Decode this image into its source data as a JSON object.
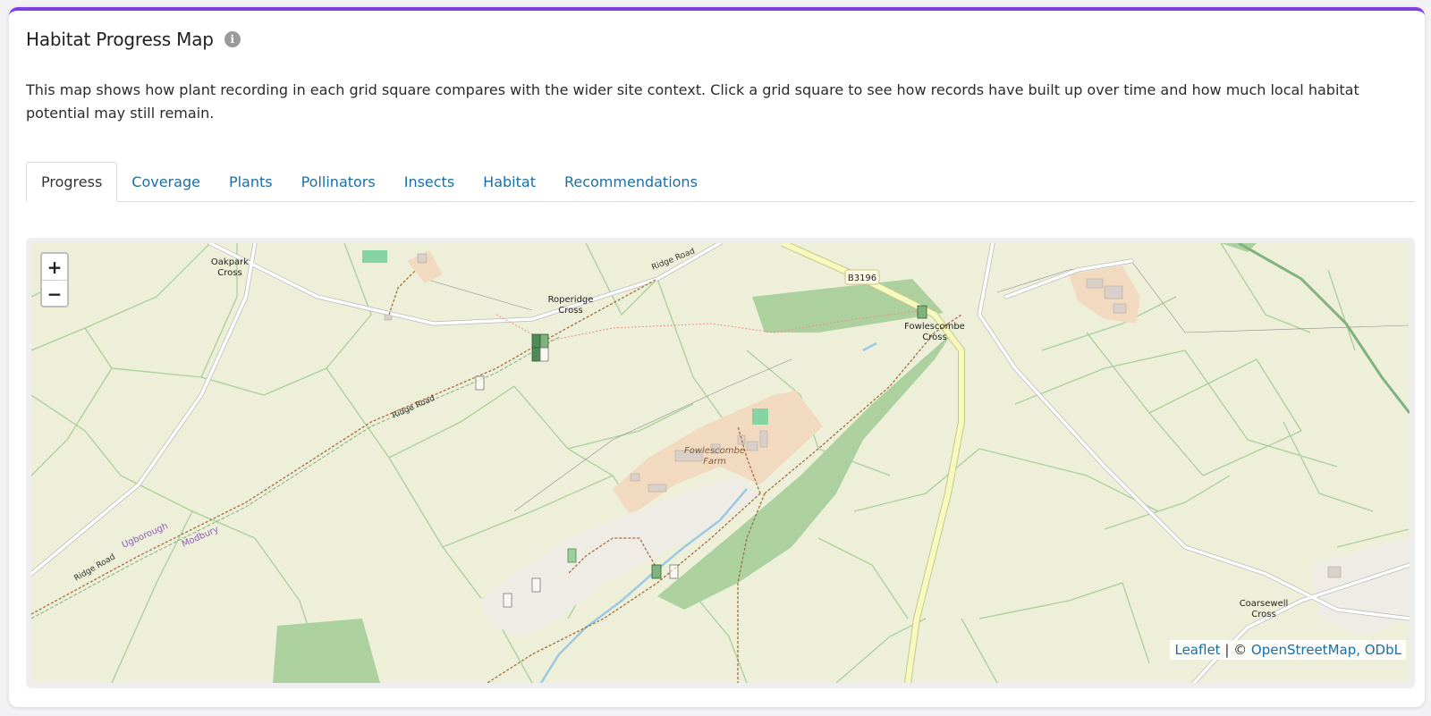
{
  "header": {
    "title": "Habitat Progress Map",
    "info_icon": "info-icon",
    "description": "This map shows how plant recording in each grid square compares with the wider site context. Click a grid square to see how records have built up over time and how much local habitat potential may still remain."
  },
  "tabs": [
    {
      "label": "Progress",
      "active": true
    },
    {
      "label": "Coverage"
    },
    {
      "label": "Plants"
    },
    {
      "label": "Pollinators"
    },
    {
      "label": "Insects"
    },
    {
      "label": "Habitat"
    },
    {
      "label": "Recommendations"
    }
  ],
  "map": {
    "zoom_in": "+",
    "zoom_out": "−",
    "labels": {
      "oakpark": [
        "Oakpark",
        "Cross"
      ],
      "roperidge": [
        "Roperidge",
        "Cross"
      ],
      "fowlescombe_cross": [
        "Fowlescombe",
        "Cross"
      ],
      "fowlescombe_farm": [
        "Fowlescombe",
        "Farm"
      ],
      "coarsewell": [
        "Coarsewell",
        "Cross"
      ],
      "ridge_road": "Ridge Road",
      "b3196": "B3196",
      "ugborough": "Ugborough",
      "modbury": "Modbury"
    },
    "attribution": {
      "leaflet": "Leaflet",
      "separator": " | © ",
      "osm": "OpenStreetMap, ODbL"
    }
  },
  "colors": {
    "accent": "#7b3fe4",
    "link": "#1a6fa8",
    "land": "#edefd9",
    "woodland": "#add19e",
    "farmyard": "#f2dac0",
    "grid_dark": "#4e8a55",
    "grid_mid": "#7fb27f"
  }
}
